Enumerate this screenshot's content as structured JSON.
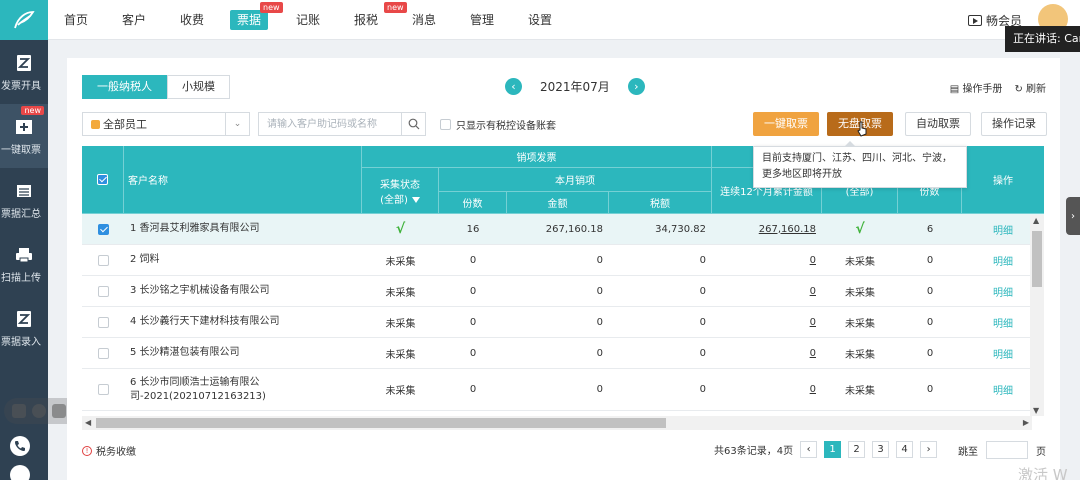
{
  "sidebar": {
    "items": [
      {
        "label": "发票开具",
        "icon": "invoice-icon"
      },
      {
        "label": "一键取票",
        "icon": "fetch-invoice-icon",
        "badge": "new"
      },
      {
        "label": "票据汇总",
        "icon": "summary-icon"
      },
      {
        "label": "扫描上传",
        "icon": "scanner-icon"
      },
      {
        "label": "票据录入",
        "icon": "entry-icon"
      }
    ]
  },
  "nav": {
    "items": [
      "首页",
      "客户",
      "收费",
      "票据",
      "记账",
      "报税",
      "消息",
      "管理",
      "设置"
    ],
    "active": "票据",
    "badges": {
      "票据": "new",
      "报税": "new"
    },
    "member": "畅会员",
    "speaking": "正在讲话: Car"
  },
  "tabs": [
    "一般纳税人",
    "小规模"
  ],
  "active_tab": "一般纳税人",
  "month": "2021年07月",
  "toolbar_right": {
    "manual": "操作手册",
    "refresh": "刷新"
  },
  "filters": {
    "staff": "全部员工",
    "search_placeholder": "请输入客户助记码或名称",
    "only_tax_device": "只显示有税控设备账套"
  },
  "buttons": {
    "one_click": "一键取票",
    "no_card": "无盘取票",
    "auto": "自动取票",
    "log": "操作记录"
  },
  "tooltip": "目前支持厦门、江苏、四川、河北、宁波，更多地区即将开放",
  "table": {
    "headers": {
      "customer": "客户名称",
      "sales_invoice": "销项发票",
      "collect_status_1": "采集状态",
      "collect_status_2": "(全部)",
      "this_month": "本月销项",
      "count": "份数",
      "amount": "金额",
      "tax": "税额",
      "rolling12": "连续12个月累计金额",
      "input_status": "(全部)",
      "input_count": "份数",
      "operation": "操作"
    },
    "rows": [
      {
        "name": "1 香河县艾利雅家具有限公司",
        "status": "√",
        "count": "16",
        "amount": "267,160.18",
        "tax": "34,730.82",
        "rolling": "267,160.18",
        "input_status": "√",
        "input_count": "6",
        "op": "明细",
        "checked": true
      },
      {
        "name": "2 饲料",
        "status": "未采集",
        "count": "0",
        "amount": "0",
        "tax": "0",
        "rolling": "0",
        "input_status": "未采集",
        "input_count": "0",
        "op": "明细",
        "checked": false
      },
      {
        "name": "3 长沙铭之宇机械设备有限公司",
        "status": "未采集",
        "count": "0",
        "amount": "0",
        "tax": "0",
        "rolling": "0",
        "input_status": "未采集",
        "input_count": "0",
        "op": "明细",
        "checked": false
      },
      {
        "name": "4 长沙義行天下建材科技有限公司",
        "status": "未采集",
        "count": "0",
        "amount": "0",
        "tax": "0",
        "rolling": "0",
        "input_status": "未采集",
        "input_count": "0",
        "op": "明细",
        "checked": false
      },
      {
        "name": "5 长沙精湛包装有限公司",
        "status": "未采集",
        "count": "0",
        "amount": "0",
        "tax": "0",
        "rolling": "0",
        "input_status": "未采集",
        "input_count": "0",
        "op": "明细",
        "checked": false
      },
      {
        "name": "6 长沙市同顺浩士运输有限公司-2021(20210712163213)",
        "status": "未采集",
        "count": "0",
        "amount": "0",
        "tax": "0",
        "rolling": "0",
        "input_status": "未采集",
        "input_count": "0",
        "op": "明细",
        "checked": false
      }
    ]
  },
  "footer": {
    "tax_collection": "税务收缴",
    "total": "共63条记录，4页",
    "pages": [
      "1",
      "2",
      "3",
      "4"
    ],
    "current_page": "1",
    "goto": "跳至",
    "page_unit": "页"
  },
  "watermark": "激活 W",
  "colors": {
    "accent": "#2cb7bd",
    "sidebar": "#2f4152",
    "orange": "#f0a340",
    "brown": "#b86b1a",
    "badge": "#e84848"
  }
}
